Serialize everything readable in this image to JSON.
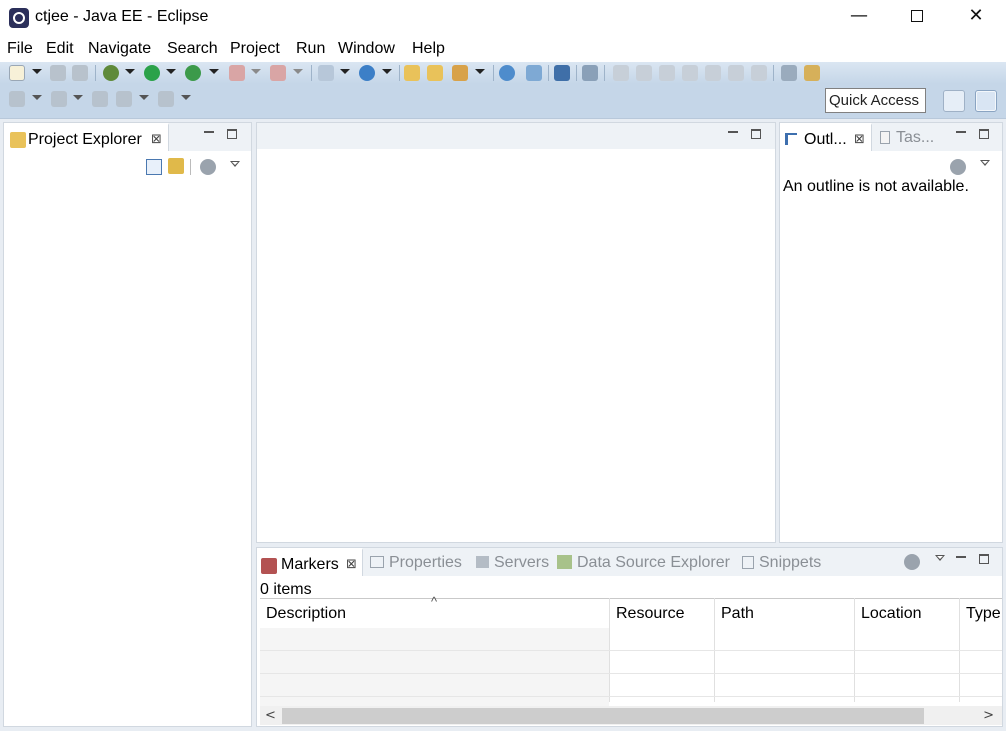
{
  "window": {
    "title": "ctjee - Java EE - Eclipse",
    "minimize": "—",
    "close": "✕"
  },
  "menu": [
    "File",
    "Edit",
    "Navigate",
    "Search",
    "Project",
    "Run",
    "Window",
    "Help"
  ],
  "toolbar": {
    "quick_access": "Quick Access"
  },
  "project_explorer": {
    "tab_label": "Project Explorer",
    "close": "⊠"
  },
  "outline": {
    "tab_label": "Outl...",
    "close": "⊠",
    "tasks_tab_label": "Tas...",
    "message": "An outline is not available."
  },
  "bottom": {
    "tabs": [
      {
        "label": "Markers",
        "active": true
      },
      {
        "label": "Properties",
        "active": false
      },
      {
        "label": "Servers",
        "active": false
      },
      {
        "label": "Data Source Explorer",
        "active": false
      },
      {
        "label": "Snippets",
        "active": false
      }
    ],
    "close": "⊠",
    "item_count": "0 items",
    "sort_indicator": "^",
    "columns": [
      "Description",
      "Resource",
      "Path",
      "Location",
      "Type"
    ],
    "scroll_left": "<",
    "scroll_right": ">"
  },
  "colors": {
    "toolbar_bg": "#c5d6e8",
    "workbench_bg": "#e8edf3",
    "tab_strip": "#eef2f6",
    "panel_border": "#d1d8e0"
  }
}
